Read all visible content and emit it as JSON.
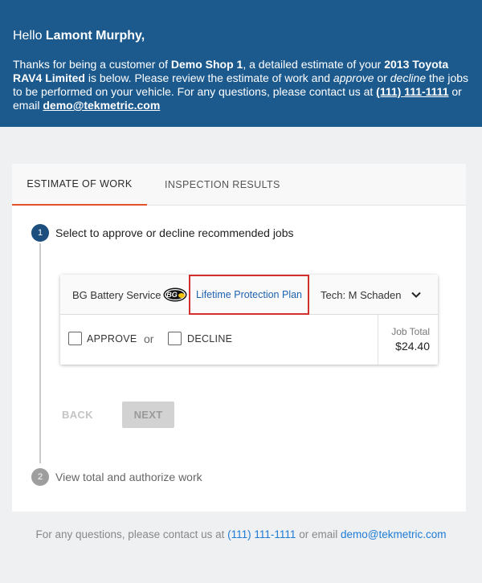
{
  "header": {
    "greeting": "Hello ",
    "customer_name": "Lamont Murphy,",
    "intro_1": "Thanks for being a customer of ",
    "shop_name": "Demo Shop 1",
    "intro_2": ", a detailed estimate of your ",
    "vehicle": "2013 Toyota RAV4 Limited",
    "intro_3": " is below. Please review the estimate of work and ",
    "approve_word": "approve",
    "intro_4": " or ",
    "decline_word": "decline",
    "intro_5": " the jobs to be performed on your vehicle. For any questions, please contact us at ",
    "phone": "(111) 111-1111",
    "intro_6": " or email ",
    "email": "demo@tekmetric.com"
  },
  "tabs": [
    {
      "label": "ESTIMATE OF WORK",
      "active": true
    },
    {
      "label": "INSPECTION RESULTS",
      "active": false
    }
  ],
  "steps": [
    {
      "number": "1",
      "label": "Select to approve or decline recommended jobs"
    },
    {
      "number": "2",
      "label": "View total and authorize work"
    }
  ],
  "job": {
    "name": "BG Battery Service",
    "logo_text": "BG",
    "plan_link": "Lifetime Protection Plan",
    "tech": "Tech: M Schaden",
    "approve_label": "APPROVE",
    "or_label": "or",
    "decline_label": "DECLINE",
    "total_label": "Job Total",
    "total_value": "$24.40"
  },
  "nav": {
    "back_label": "BACK",
    "next_label": "NEXT"
  },
  "footer": {
    "text_1": "For any questions, please contact us at ",
    "phone": "(111) 111-1111",
    "text_2": " or email ",
    "email": "demo@tekmetric.com"
  },
  "colors": {
    "header_bg": "#1c5a8e",
    "tab_active_underline": "#e1522b",
    "link": "#1e62b0",
    "highlight_border": "#d32f2f"
  }
}
